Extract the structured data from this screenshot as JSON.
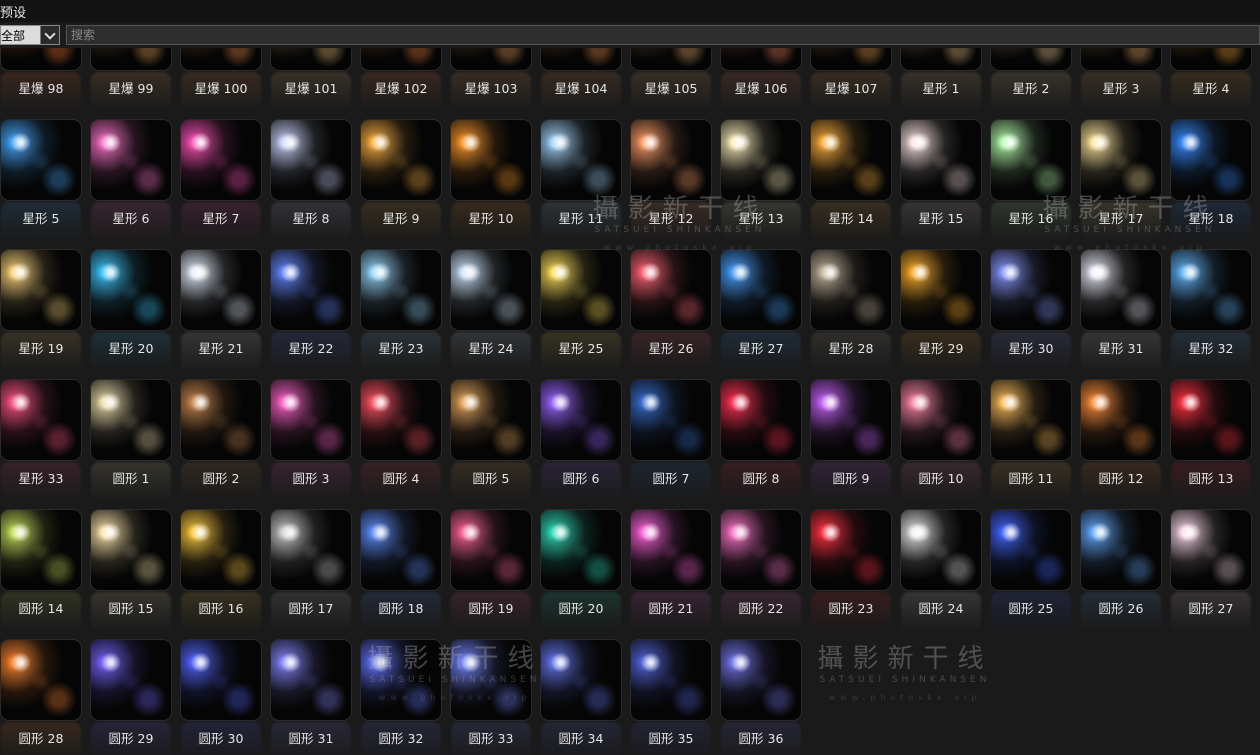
{
  "window": {
    "title": "预设"
  },
  "filter": {
    "category": "全部",
    "search_placeholder": "搜索"
  },
  "watermark": {
    "text": "攝影新干线",
    "subtitle": "SATSUEI SHINKANSEN",
    "url": "www.photoskx.vip"
  },
  "presets": [
    {
      "label": "星爆 98",
      "color": "#ff7a3a"
    },
    {
      "label": "星爆 99",
      "color": "#ffb060"
    },
    {
      "label": "星爆 100",
      "color": "#ff9a50"
    },
    {
      "label": "星爆 101",
      "color": "#ffcc80"
    },
    {
      "label": "星爆 102",
      "color": "#ff8844"
    },
    {
      "label": "星爆 103",
      "color": "#ffaa66"
    },
    {
      "label": "星爆 104",
      "color": "#ff9955"
    },
    {
      "label": "星爆 105",
      "color": "#ffbb77"
    },
    {
      "label": "星爆 106",
      "color": "#ff8866"
    },
    {
      "label": "星爆 107",
      "color": "#ffaa55"
    },
    {
      "label": "星形 1",
      "color": "#ffd090"
    },
    {
      "label": "星形 2",
      "color": "#ffe0a0"
    },
    {
      "label": "星形 3",
      "color": "#ffc070"
    },
    {
      "label": "星形 4",
      "color": "#ffaa40"
    },
    {
      "label": "星形 5",
      "color": "#4aa8ff"
    },
    {
      "label": "星形 6",
      "color": "#ff77cc"
    },
    {
      "label": "星形 7",
      "color": "#ff55bb"
    },
    {
      "label": "星形 8",
      "color": "#cfd8ff"
    },
    {
      "label": "星形 9",
      "color": "#ffb347"
    },
    {
      "label": "星形 10",
      "color": "#ff9a2e"
    },
    {
      "label": "星形 11",
      "color": "#a9d8ff"
    },
    {
      "label": "星形 12",
      "color": "#ff9f6a"
    },
    {
      "label": "星形 13",
      "color": "#fff2c0"
    },
    {
      "label": "星形 14",
      "color": "#ffb040"
    },
    {
      "label": "星形 15",
      "color": "#ffe6e6"
    },
    {
      "label": "星形 16",
      "color": "#b8ffb0"
    },
    {
      "label": "星形 17",
      "color": "#ffe6a0"
    },
    {
      "label": "星形 18",
      "color": "#3a8cff"
    },
    {
      "label": "星形 19",
      "color": "#ffd780"
    },
    {
      "label": "星形 20",
      "color": "#40c8ff"
    },
    {
      "label": "星形 21",
      "color": "#e8f0ff"
    },
    {
      "label": "星形 22",
      "color": "#6688ff"
    },
    {
      "label": "星形 23",
      "color": "#9ad8ff"
    },
    {
      "label": "星形 24",
      "color": "#d0e8ff"
    },
    {
      "label": "星形 25",
      "color": "#ffe060"
    },
    {
      "label": "星形 26",
      "color": "#ff6677"
    },
    {
      "label": "星形 27",
      "color": "#4aa0ff"
    },
    {
      "label": "星形 28",
      "color": "#c8b8a0"
    },
    {
      "label": "星形 29",
      "color": "#ffb030"
    },
    {
      "label": "星形 30",
      "color": "#8899ff"
    },
    {
      "label": "星形 31",
      "color": "#f0f0ff"
    },
    {
      "label": "星形 32",
      "color": "#66b8ff"
    },
    {
      "label": "星形 33",
      "color": "#ff5588"
    },
    {
      "label": "圆形 1",
      "color": "#f0e0b0"
    },
    {
      "label": "圆形 2",
      "color": "#c88850"
    },
    {
      "label": "圆形 3",
      "color": "#ff66cc"
    },
    {
      "label": "圆形 4",
      "color": "#ff5566"
    },
    {
      "label": "圆形 5",
      "color": "#e8a860"
    },
    {
      "label": "圆形 6",
      "color": "#9966ff"
    },
    {
      "label": "圆形 7",
      "color": "#3a70d0"
    },
    {
      "label": "圆形 8",
      "color": "#ff3355"
    },
    {
      "label": "圆形 9",
      "color": "#cc66ff"
    },
    {
      "label": "圆形 10",
      "color": "#ff88aa"
    },
    {
      "label": "圆形 11",
      "color": "#ffc060"
    },
    {
      "label": "圆形 12",
      "color": "#ff9040"
    },
    {
      "label": "圆形 13",
      "color": "#ff3344"
    },
    {
      "label": "圆形 14",
      "color": "#c8e060"
    },
    {
      "label": "圆形 15",
      "color": "#ffe8b0"
    },
    {
      "label": "圆形 16",
      "color": "#ffcc44"
    },
    {
      "label": "圆形 17",
      "color": "#d0d0d0"
    },
    {
      "label": "圆形 18",
      "color": "#6090ff"
    },
    {
      "label": "圆形 19",
      "color": "#ff6699"
    },
    {
      "label": "圆形 20",
      "color": "#33ddbb"
    },
    {
      "label": "圆形 21",
      "color": "#ff66dd"
    },
    {
      "label": "圆形 22",
      "color": "#ff77cc"
    },
    {
      "label": "圆形 23",
      "color": "#ff3344"
    },
    {
      "label": "圆形 24",
      "color": "#f0f0f0"
    },
    {
      "label": "圆形 25",
      "color": "#4466ff"
    },
    {
      "label": "圆形 26",
      "color": "#66aaff"
    },
    {
      "label": "圆形 27",
      "color": "#ffddee"
    },
    {
      "label": "圆形 28",
      "color": "#ff8833"
    },
    {
      "label": "圆形 29",
      "color": "#7766ff"
    },
    {
      "label": "圆形 30",
      "color": "#5566ff"
    },
    {
      "label": "圆形 31",
      "color": "#8888ff"
    },
    {
      "label": "圆形 32",
      "color": "#6677ff"
    },
    {
      "label": "圆形 33",
      "color": "#7788ff"
    },
    {
      "label": "圆形 34",
      "color": "#6677ee"
    },
    {
      "label": "圆形 35",
      "color": "#5566dd"
    },
    {
      "label": "圆形 36",
      "color": "#7777ee"
    }
  ]
}
